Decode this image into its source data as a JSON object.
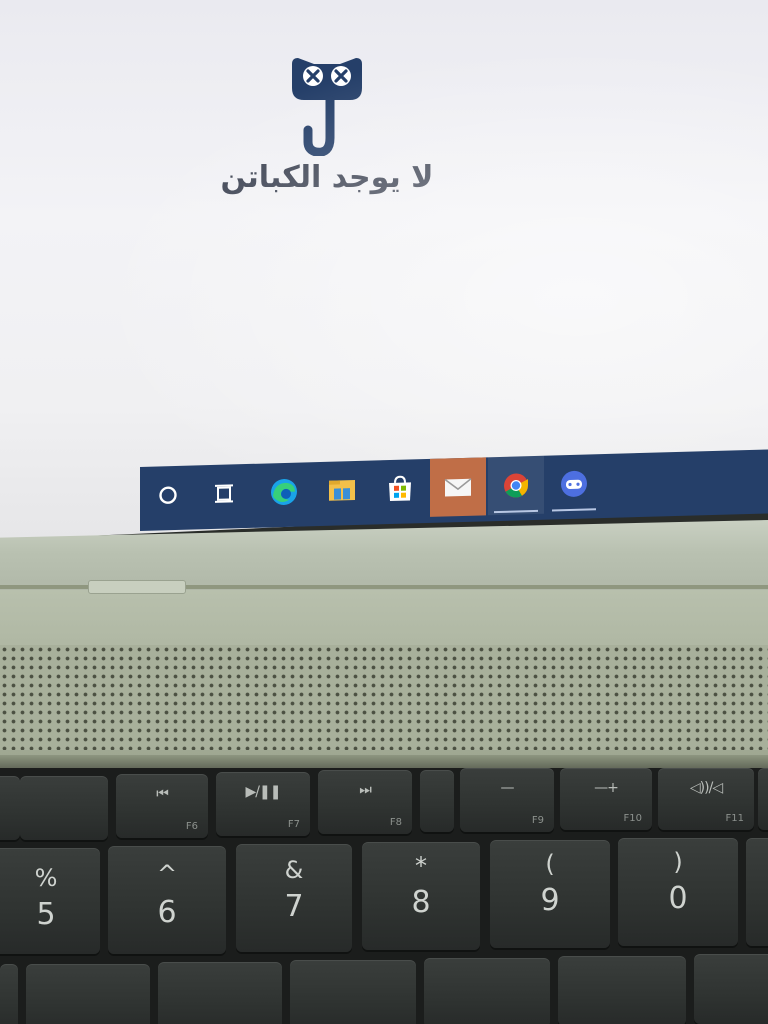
{
  "screen": {
    "empty_state_text": "لا يوجد الكباتن",
    "logo_icon": "owl-mascot-icon",
    "accent_color": "#253f69"
  },
  "taskbar": {
    "color": "#253f69",
    "items": [
      {
        "icon": "cortana-search-icon"
      },
      {
        "icon": "task-view-icon"
      },
      {
        "icon": "edge-browser-icon"
      },
      {
        "icon": "file-explorer-icon"
      },
      {
        "icon": "microsoft-store-icon"
      },
      {
        "icon": "mail-icon",
        "state": "active"
      },
      {
        "icon": "chrome-icon",
        "state": "running"
      },
      {
        "icon": "gamepad-app-icon",
        "state": "running"
      }
    ]
  },
  "keyboard": {
    "function_row": [
      {
        "glyph": "⏮",
        "fn": "F6"
      },
      {
        "glyph": "▶/❚❚",
        "fn": "F7"
      },
      {
        "glyph": "⏭",
        "fn": "F8"
      },
      {
        "glyph": "—",
        "fn": "F9"
      },
      {
        "glyph": "—+",
        "fn": "F10"
      },
      {
        "glyph": "◁))/◁",
        "fn": "F11"
      }
    ],
    "number_row": [
      {
        "shift": "%",
        "main": "5"
      },
      {
        "shift": "^",
        "main": "6"
      },
      {
        "shift": "&",
        "main": "7"
      },
      {
        "shift": "*",
        "main": "8"
      },
      {
        "shift": "(",
        "main": "9"
      },
      {
        "shift": ")",
        "main": "0"
      }
    ]
  }
}
